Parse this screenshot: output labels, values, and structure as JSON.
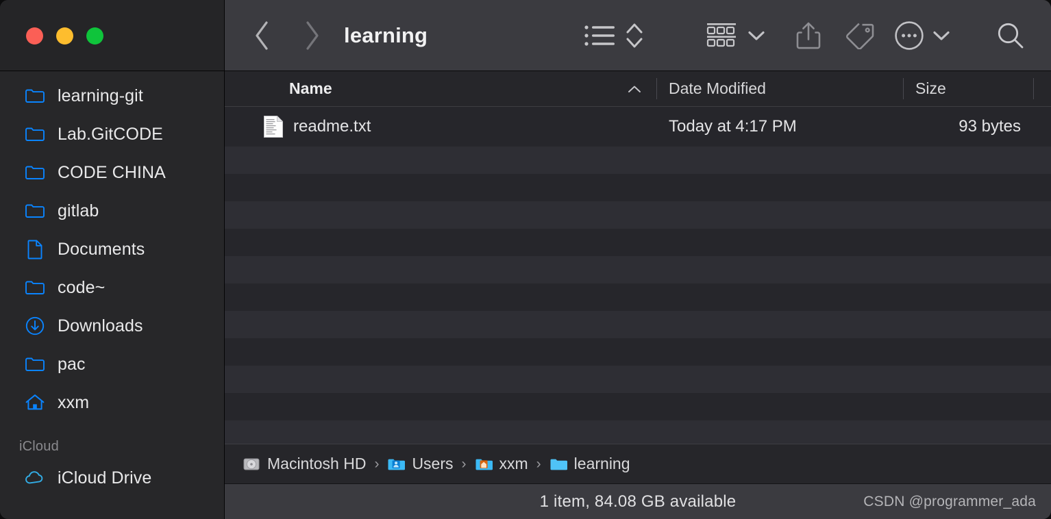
{
  "window": {
    "title": "learning",
    "traffic_lights": [
      {
        "name": "close",
        "color": "#fb5f56"
      },
      {
        "name": "minimize",
        "color": "#fdbd2e"
      },
      {
        "name": "maximize",
        "color": "#0fc43b"
      }
    ]
  },
  "toolbar": {
    "back_icon": "chevron-left-icon",
    "forward_icon": "chevron-right-icon",
    "title": "learning",
    "view_mode_icon": "list-view-icon",
    "sort_arrows_icon": "up-down-chevron-icon",
    "group_icon": "group-by-icon",
    "group_chevron_icon": "chevron-down-icon",
    "share_icon": "share-icon",
    "tag_icon": "tag-icon",
    "more_icon": "ellipsis-circle-icon",
    "more_chevron_icon": "chevron-down-icon",
    "search_icon": "search-icon"
  },
  "columns": [
    {
      "key": "name",
      "label": "Name",
      "sorted": true,
      "sort_direction": "ascending"
    },
    {
      "key": "date",
      "label": "Date Modified"
    },
    {
      "key": "size",
      "label": "Size"
    }
  ],
  "files": [
    {
      "icon": "text-document-icon",
      "name": "readme.txt",
      "date_modified": "Today at 4:17 PM",
      "size": "93 bytes"
    }
  ],
  "sidebar": {
    "items": [
      {
        "icon": "folder-icon",
        "label": "learning-git"
      },
      {
        "icon": "folder-icon",
        "label": "Lab.GitCODE"
      },
      {
        "icon": "folder-icon",
        "label": "CODE CHINA"
      },
      {
        "icon": "folder-icon",
        "label": "gitlab"
      },
      {
        "icon": "document-icon",
        "label": "Documents"
      },
      {
        "icon": "folder-icon",
        "label": "code~"
      },
      {
        "icon": "download-icon",
        "label": "Downloads"
      },
      {
        "icon": "folder-icon",
        "label": "pac"
      },
      {
        "icon": "home-icon",
        "label": "xxm"
      }
    ],
    "sections": [
      {
        "header": "iCloud",
        "items": [
          {
            "icon": "cloud-icon",
            "label": "iCloud Drive"
          }
        ]
      }
    ]
  },
  "path_bar": {
    "segments": [
      {
        "icon": "hard-drive-icon",
        "label": "Macintosh HD"
      },
      {
        "icon": "users-folder-icon",
        "label": "Users"
      },
      {
        "icon": "home-folder-icon",
        "label": "xxm"
      },
      {
        "icon": "folder-blue-icon",
        "label": "learning"
      }
    ],
    "separator": "›"
  },
  "status_bar": {
    "text": "1 item, 84.08 GB available",
    "watermark": "CSDN @programmer_ada"
  },
  "colors": {
    "accent_blue": "#0a84ff",
    "window_bg": "#26262a",
    "toolbar_bg": "#3b3b40",
    "sidebar_bg": "#272729",
    "row_odd": "#26262b",
    "row_even": "#2e2e34"
  }
}
